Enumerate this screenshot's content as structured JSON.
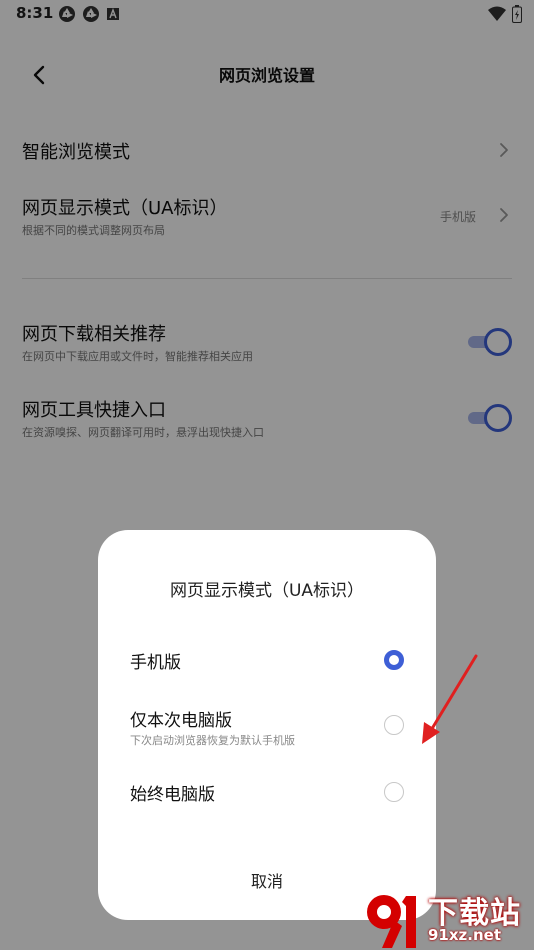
{
  "status_bar": {
    "time": "8:31"
  },
  "app_bar": {
    "title": "网页浏览设置"
  },
  "settings": {
    "smart_mode": {
      "title": "智能浏览模式"
    },
    "ua_mode": {
      "title": "网页显示模式（UA标识）",
      "subtitle": "根据不同的模式调整网页布局",
      "value": "手机版"
    },
    "download_recommend": {
      "title": "网页下载相关推荐",
      "subtitle": "在网页中下载应用或文件时，智能推荐相关应用",
      "enabled": true
    },
    "tool_shortcut": {
      "title": "网页工具快捷入口",
      "subtitle": "在资源嗅探、网页翻译可用时，悬浮出现快捷入口",
      "enabled": true
    }
  },
  "dialog": {
    "title": "网页显示模式（UA标识）",
    "options": [
      {
        "label": "手机版",
        "checked": true
      },
      {
        "label": "仅本次电脑版",
        "subtitle": "下次启动浏览器恢复为默认手机版",
        "checked": false
      },
      {
        "label": "始终电脑版",
        "checked": false
      }
    ],
    "cancel_label": "取消"
  },
  "watermark": {
    "main": "下载站",
    "sub": "91xz.net"
  },
  "colors": {
    "accent": "#3e5fd6",
    "annotation_arrow": "#e02020",
    "watermark": "#d40000"
  }
}
